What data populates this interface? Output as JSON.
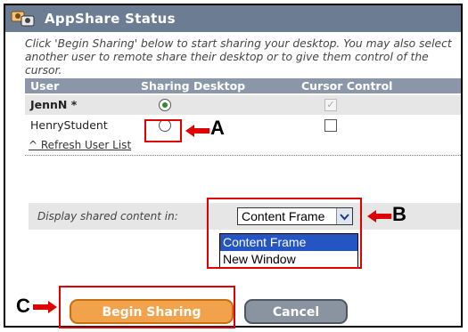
{
  "window": {
    "title": "AppShare Status",
    "icon": "users-share-icon"
  },
  "instructions": "Click 'Begin Sharing' below to start sharing your desktop. You may also select another user to remote share their desktop or to give them control of the cursor.",
  "table": {
    "headers": [
      "User",
      "Sharing Desktop",
      "Cursor Control"
    ],
    "rows": [
      {
        "user": "JennN *",
        "sharing_desktop": true,
        "cursor_control": true,
        "cursor_control_disabled": true
      },
      {
        "user": "HenryStudent",
        "sharing_desktop": false,
        "cursor_control": false,
        "cursor_control_disabled": false
      }
    ]
  },
  "refresh_link": "^ Refresh User List",
  "display": {
    "label": "Display shared content in:",
    "selected": "Content Frame",
    "options": [
      "Content Frame",
      "New Window"
    ]
  },
  "buttons": {
    "begin_sharing": "Begin Sharing",
    "cancel": "Cancel"
  },
  "callouts": {
    "a": "A",
    "b": "B",
    "c": "C"
  },
  "colors": {
    "title_bar": "#6b7c93",
    "header_row": "#8b97a8",
    "highlight": "#e00000",
    "begin_button": "#f2a24b",
    "cancel_button": "#8a93a0",
    "selected_option": "#2455c3"
  }
}
